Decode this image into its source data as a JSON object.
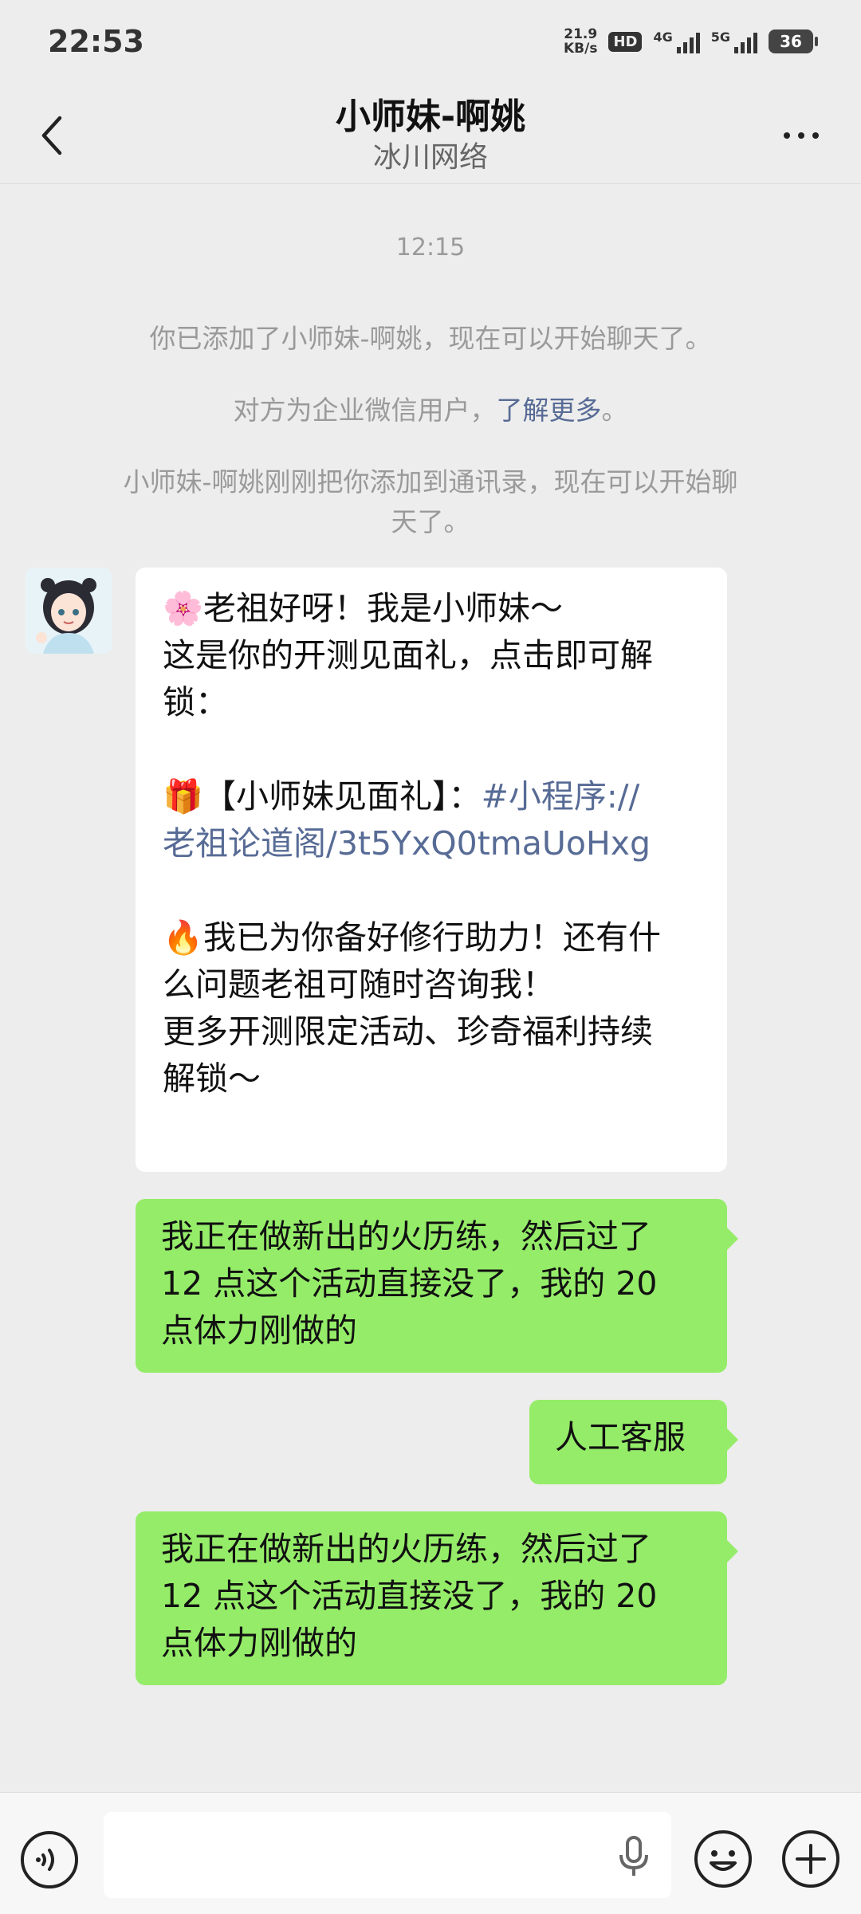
{
  "status": {
    "time": "22:53",
    "netspeed_value": "21.9",
    "netspeed_unit": "KB/s",
    "hd_label": "HD",
    "signal1_label": "4G",
    "signal2_label": "5G",
    "battery": "36"
  },
  "header": {
    "title": "小师妹-啊姚",
    "subtitle": "冰川网络"
  },
  "chat": {
    "timestamp": "12:15",
    "system_added": "你已添加了小师妹-啊姚，现在可以开始聊天了。",
    "system_enterprise_prefix": "对方为企业微信用户，",
    "system_enterprise_link": "了解更多",
    "system_enterprise_suffix": "。",
    "system_contacts_line1": "小师妹-啊姚刚刚把你添加到通讯录，现在可以开始聊",
    "system_contacts_line2": "天了。",
    "incoming": {
      "line1": "🌸老祖好呀！我是小师妹～",
      "line2": "这是你的开测见面礼，点击即可解",
      "line3": "锁：",
      "line4_text": "🎁【小师妹见面礼】：",
      "line4_link": "#小程序://",
      "line5_link": "老祖论道阁/3t5YxQ0tmaUoHxg",
      "line6": "🔥我已为你备好修行助力！还有什",
      "line7": "么问题老祖可随时咨询我！",
      "line8": "更多开测限定活动、珍奇福利持续",
      "line9": "解锁～"
    },
    "outgoing": [
      {
        "line1": "我正在做新出的火历练，然后过了",
        "line2": "12 点这个活动直接没了，我的 20",
        "line3": "点体力刚做的"
      },
      {
        "line1": "人工客服"
      },
      {
        "line1": "我正在做新出的火历练，然后过了",
        "line2": "12 点这个活动直接没了，我的 20",
        "line3": "点体力刚做的"
      }
    ]
  },
  "input": {
    "value": ""
  },
  "colors": {
    "background": "#ededed",
    "outgoing_bubble": "#95ec69",
    "link": "#576b95"
  },
  "icons": [
    "back-icon",
    "more-icon",
    "voice-icon",
    "mic-icon",
    "emoji-icon",
    "plus-icon"
  ]
}
